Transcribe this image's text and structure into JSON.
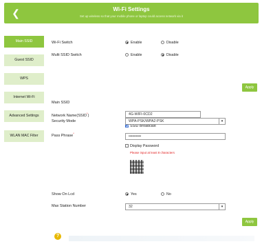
{
  "header": {
    "back_icon": "chevron-left-icon",
    "title": "Wi-Fi Settings",
    "subtitle": "Set up wireless so that your mobile phone or laptop could access network via it"
  },
  "sidebar": {
    "items": [
      {
        "label": "Main SSID",
        "active": true
      },
      {
        "label": "Guest SSID",
        "active": false
      },
      {
        "label": "WPS",
        "active": false
      },
      {
        "label": "Internet Wi-Fi",
        "active": false
      },
      {
        "label": "Advanced Settings",
        "active": false
      },
      {
        "label": "WLAN MAC Filter",
        "active": false
      }
    ]
  },
  "wifi_switch": {
    "label": "Wi-Fi Switch",
    "options": [
      "Enable",
      "Disable"
    ],
    "selected": "Enable"
  },
  "multi_ssid": {
    "label": "Multi SSID Switch",
    "options": [
      "Enable",
      "Disable"
    ],
    "selected": "Disable"
  },
  "apply_label": "Apply",
  "main_ssid": {
    "section_title": "Main SSID",
    "network_name_label": "Network Name(SSID",
    "network_name_suffix": ")",
    "required_mark": "*",
    "network_name_value": "4G-WIFI-0CD2",
    "ssid_broadcast_label": "SSID Broadcast",
    "ssid_broadcast_checked": true,
    "security_mode_label": "Security Mode",
    "security_mode_value": "WPA-PSK/WPA2-PSK",
    "pass_phrase_label": "Pass Phrase",
    "pass_phrase_value": "••••••••••",
    "display_password_label": "Display Password",
    "display_password_checked": false,
    "password_hint": "Please input at least 8 characters"
  },
  "show_on_lcd": {
    "label": "Show On Lcd",
    "options": [
      "Yes",
      "No"
    ],
    "selected": "Yes"
  },
  "max_station": {
    "label": "Max Station Number",
    "value": "32"
  },
  "footer": {
    "help_icon": "help-icon",
    "help_glyph": "?"
  }
}
